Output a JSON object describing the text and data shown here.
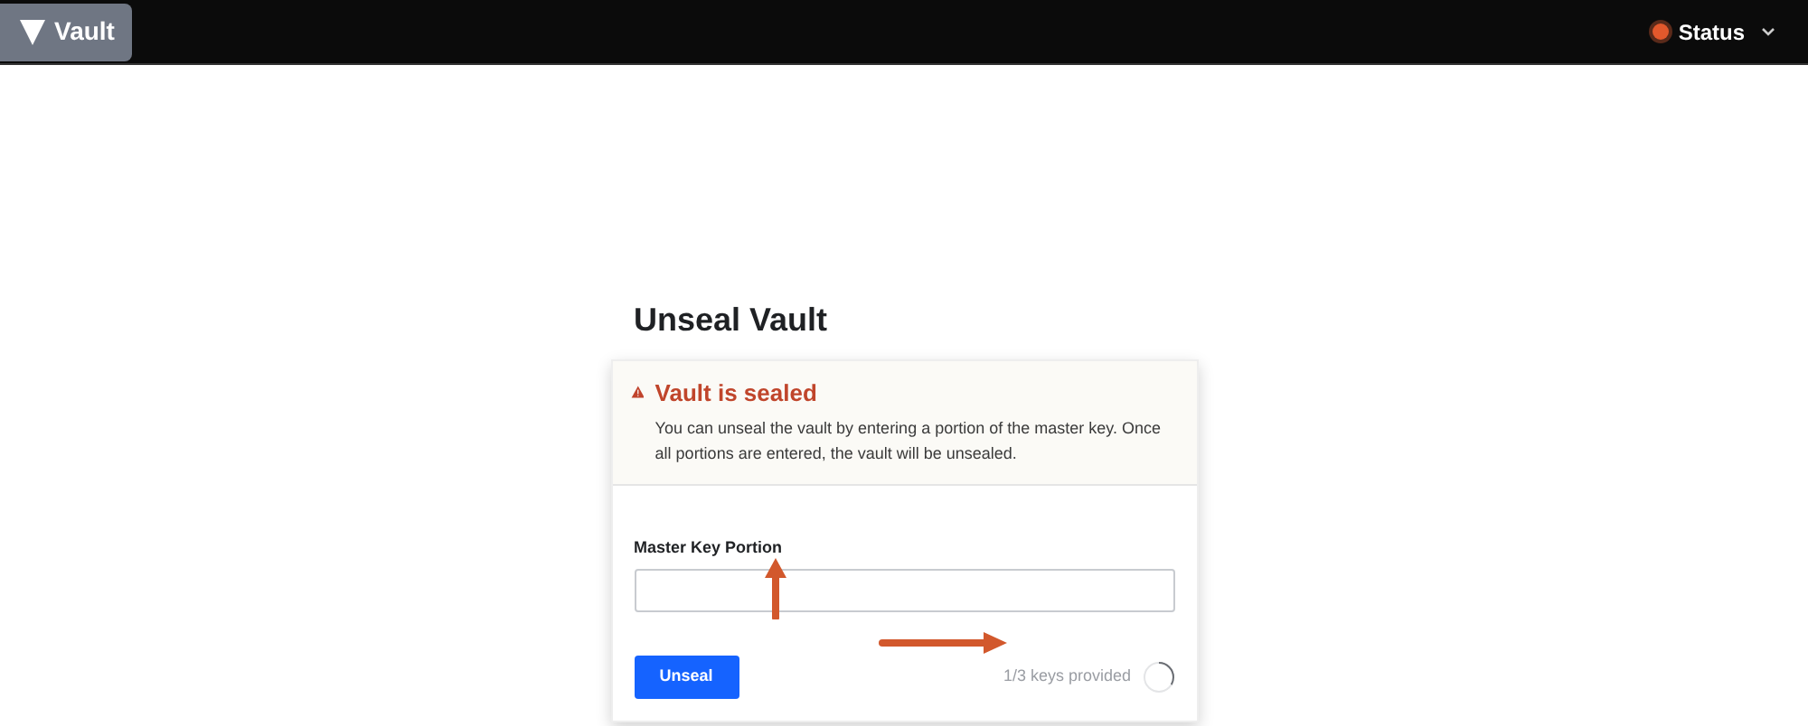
{
  "header": {
    "logo": {
      "label": "Vault"
    },
    "status": {
      "label": "Status",
      "color": "#e2582c"
    }
  },
  "title": "Unseal Vault",
  "alert": {
    "title": "Vault is sealed",
    "message": "You can unseal the vault by entering a portion of the master key. Once all portions are entered, the vault will be unsealed."
  },
  "form": {
    "field_label": "Master Key Portion",
    "button": "Unseal",
    "progress_text": "1/3 keys provided",
    "progress": {
      "level": 0.333
    }
  }
}
